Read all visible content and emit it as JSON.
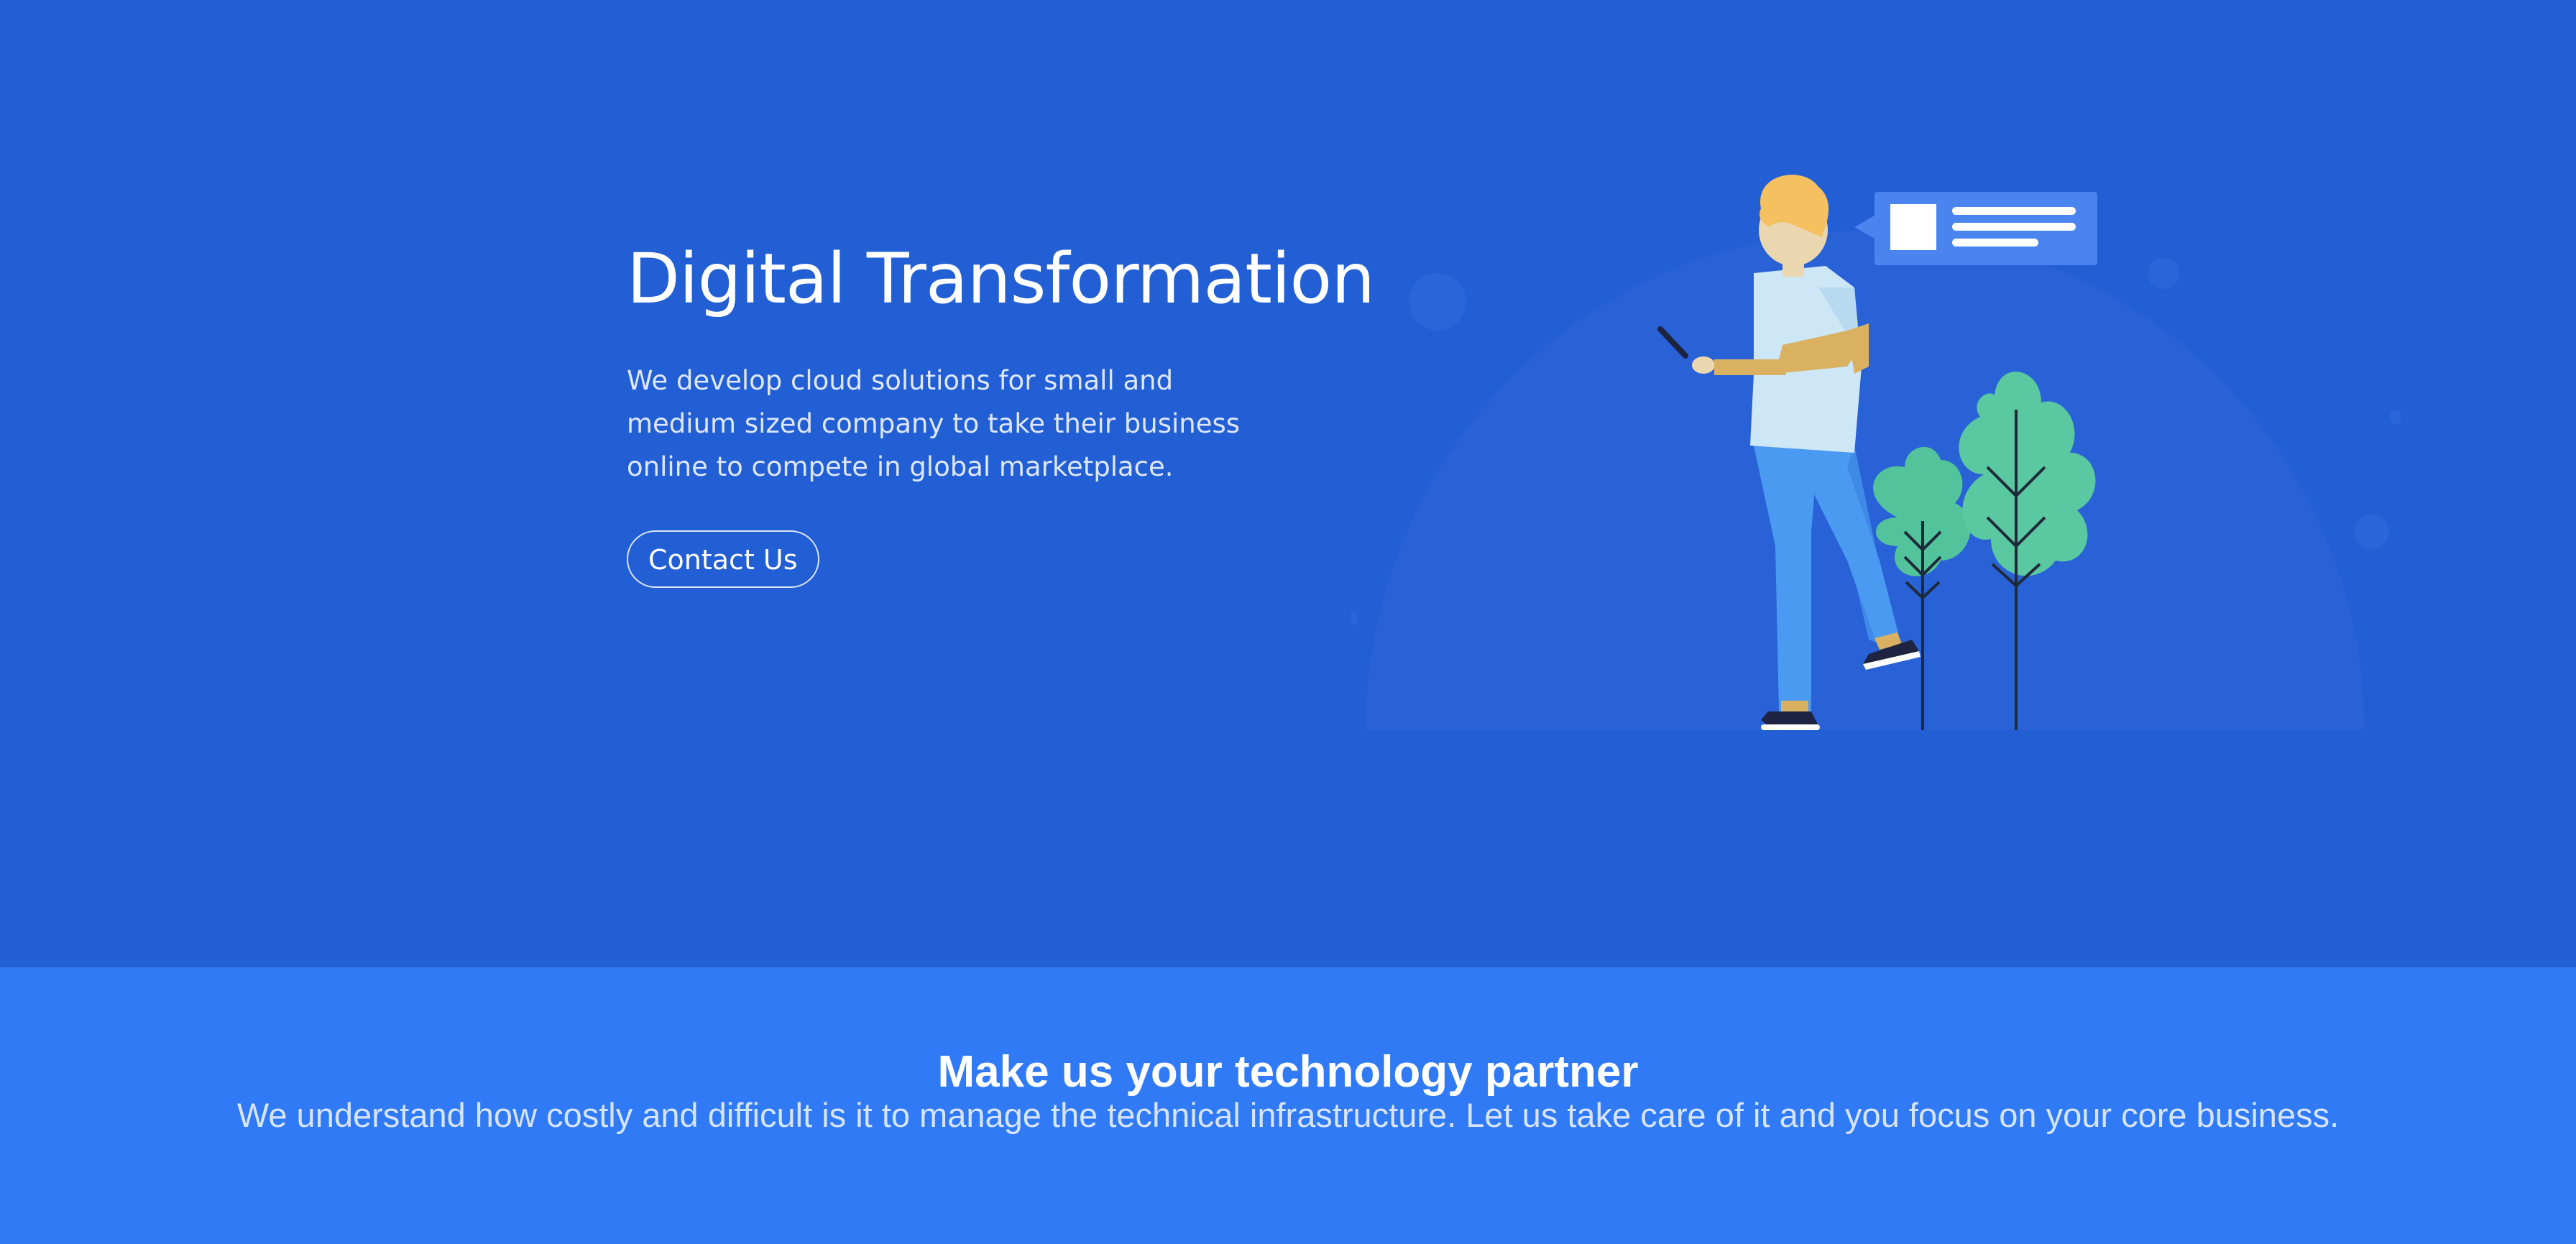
{
  "hero": {
    "title": "Digital Transformation",
    "description": "We develop cloud solutions for small and medium sized company to take their business online to compete in global marketplace.",
    "cta_label": "Contact Us"
  },
  "partner": {
    "title": "Make us your technology partner",
    "subtitle": "We understand how costly and difficult is it to manage the technical infrastructure. Let us take care of it and you focus on your core business."
  },
  "illustration": {
    "icon": "person-using-phone-illustration"
  },
  "colors": {
    "hero_bg": "#225ed4",
    "band_bg": "#307af5",
    "text_primary": "#ffffff",
    "text_secondary": "#dde7fb",
    "leaf_green": "#5ac8a0",
    "pants_blue": "#4b9af2",
    "hair_yellow": "#f5c060"
  }
}
